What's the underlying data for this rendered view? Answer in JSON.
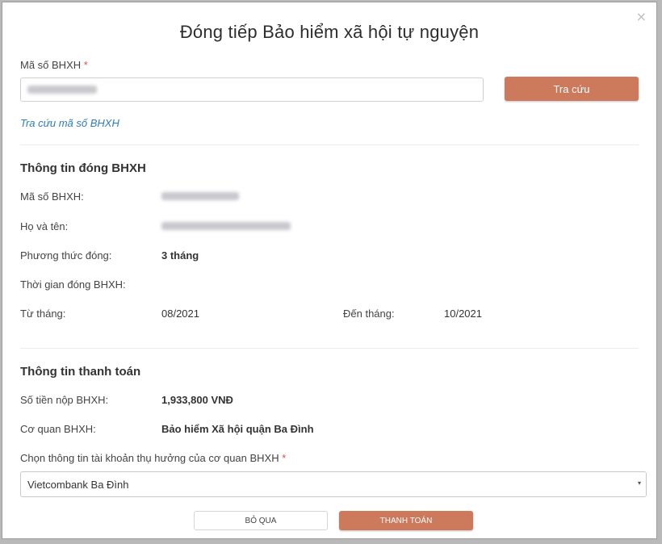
{
  "dialog": {
    "title": "Đóng tiếp Bảo hiểm xã hội tự nguyện",
    "close_icon": "×"
  },
  "lookup": {
    "label": "Mã số BHXH",
    "required_mark": "*",
    "input_value_blurred": true,
    "button_label": "Tra cứu",
    "link_label": "Tra cứu mã số BHXH"
  },
  "payment_info": {
    "heading": "Thông tin đóng BHXH",
    "code_label": "Mã số BHXH:",
    "name_label": "Họ và tên:",
    "method_label": "Phương thức đóng:",
    "method_value": "3 tháng",
    "period_label": "Thời gian đóng BHXH:",
    "from_label": "Từ tháng:",
    "from_value": "08/2021",
    "to_label": "Đến tháng:",
    "to_value": "10/2021"
  },
  "billing": {
    "heading": "Thông tin thanh toán",
    "amount_label": "Số tiền nộp BHXH:",
    "amount_value": "1,933,800 VNĐ",
    "agency_label": "Cơ quan BHXH:",
    "agency_value": "Bảo hiểm Xã hội quận Ba Đình",
    "account_label": "Chọn thông tin tài khoản thụ hưởng của cơ quan BHXH",
    "required_mark": "*",
    "account_selected": "Vietcombank Ba Đình",
    "caret_icon": "▾"
  },
  "actions": {
    "cancel_label": "BỎ QUA",
    "pay_label": "THANH TOÁN"
  },
  "colors": {
    "primary": "#cc7a5b",
    "link": "#2e7bbf",
    "required": "#d9534f"
  }
}
